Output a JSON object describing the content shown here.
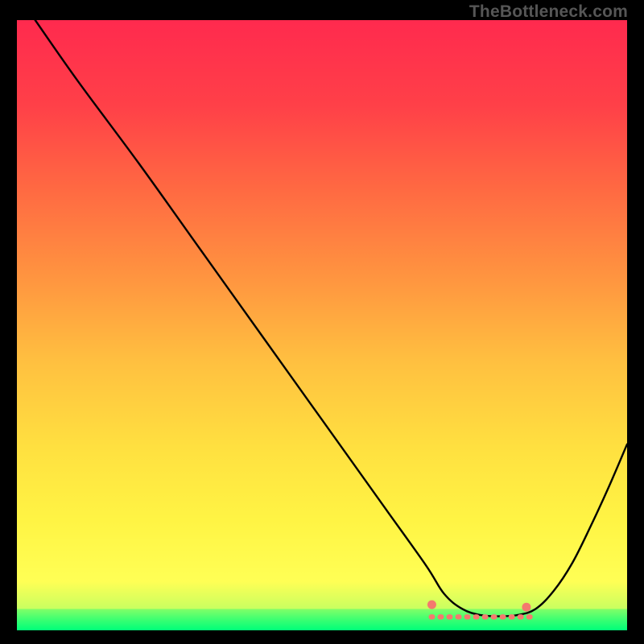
{
  "watermark": "TheBottleneck.com",
  "chart_data": {
    "type": "line",
    "title": "",
    "xlabel": "",
    "ylabel": "",
    "xlim": [
      0,
      100
    ],
    "ylim": [
      0,
      100
    ],
    "series": [
      {
        "name": "curve",
        "x": [
          3,
          10,
          20,
          30,
          40,
          50,
          60,
          67,
          70,
          73,
          76,
          79,
          82,
          85,
          88,
          91,
          94,
          97,
          100
        ],
        "y": [
          100,
          90,
          76.5,
          62.5,
          48.5,
          34.5,
          20.5,
          10.7,
          6.0,
          3.5,
          2.5,
          2.3,
          2.5,
          3.5,
          6.5,
          11.0,
          17.0,
          23.5,
          30.5
        ]
      }
    ],
    "flat_markers": {
      "x_start": 68,
      "x_end": 84,
      "y": 2.2,
      "count": 12,
      "end_markers": [
        {
          "x": 68,
          "y": 4.2
        },
        {
          "x": 83.5,
          "y": 3.8
        }
      ],
      "color": "#f47a6e"
    },
    "gradient_stops": [
      {
        "offset": 0.0,
        "color": "#ff2a4e"
      },
      {
        "offset": 0.14,
        "color": "#ff4048"
      },
      {
        "offset": 0.28,
        "color": "#ff6a42"
      },
      {
        "offset": 0.42,
        "color": "#ff9440"
      },
      {
        "offset": 0.56,
        "color": "#ffc040"
      },
      {
        "offset": 0.7,
        "color": "#ffe040"
      },
      {
        "offset": 0.82,
        "color": "#fff444"
      },
      {
        "offset": 0.92,
        "color": "#ffff55"
      },
      {
        "offset": 0.965,
        "color": "#c8ff60"
      },
      {
        "offset": 0.985,
        "color": "#4eff70"
      },
      {
        "offset": 1.0,
        "color": "#00ff7a"
      }
    ],
    "green_band": {
      "top": 0.965,
      "bottom": 1.0
    }
  }
}
